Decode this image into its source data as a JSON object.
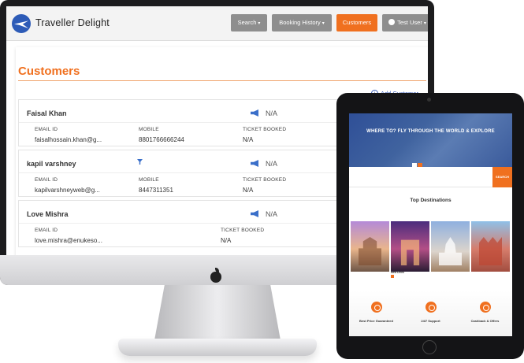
{
  "app": {
    "brand": "Traveller Delight",
    "nav": {
      "search_label": "Search",
      "booking_label": "Booking History",
      "customers_label": "Customers",
      "user_label": "Test User"
    }
  },
  "page": {
    "title": "Customers",
    "add_customer_label": "Add Customer"
  },
  "labels": {
    "email": "EMAIL ID",
    "mobile": "MOBILE",
    "ticket": "TICKET BOOKED"
  },
  "customers": [
    {
      "name": "Faisal Khan",
      "status": "N/A",
      "email": "faisalhossain.khan@g...",
      "mobile": "8801766666244",
      "ticket": "N/A"
    },
    {
      "name": "kapil varshney",
      "status": "N/A",
      "email": "kapilvarshneyweb@g...",
      "mobile": "8447311351",
      "ticket": "N/A"
    },
    {
      "name": "Love Mishra",
      "status": "N/A",
      "email": "love.mishra@enukeso...",
      "ticket": "N/A"
    }
  ],
  "tablet": {
    "hero_title": "WHERE TO? FLY THROUGH THE WORLD & EXPLORE",
    "search_button": "SEARCH",
    "destinations_title": "Top Destinations",
    "destination_label": "New Delhi",
    "features": [
      {
        "title": "Best Price Guaranteed"
      },
      {
        "title": "24/7 Support"
      },
      {
        "title": "Cashback & Offers"
      }
    ]
  },
  "colors": {
    "accent": "#f0701f",
    "nav_gray": "#8e8e8e",
    "link_blue": "#3a5db8"
  }
}
